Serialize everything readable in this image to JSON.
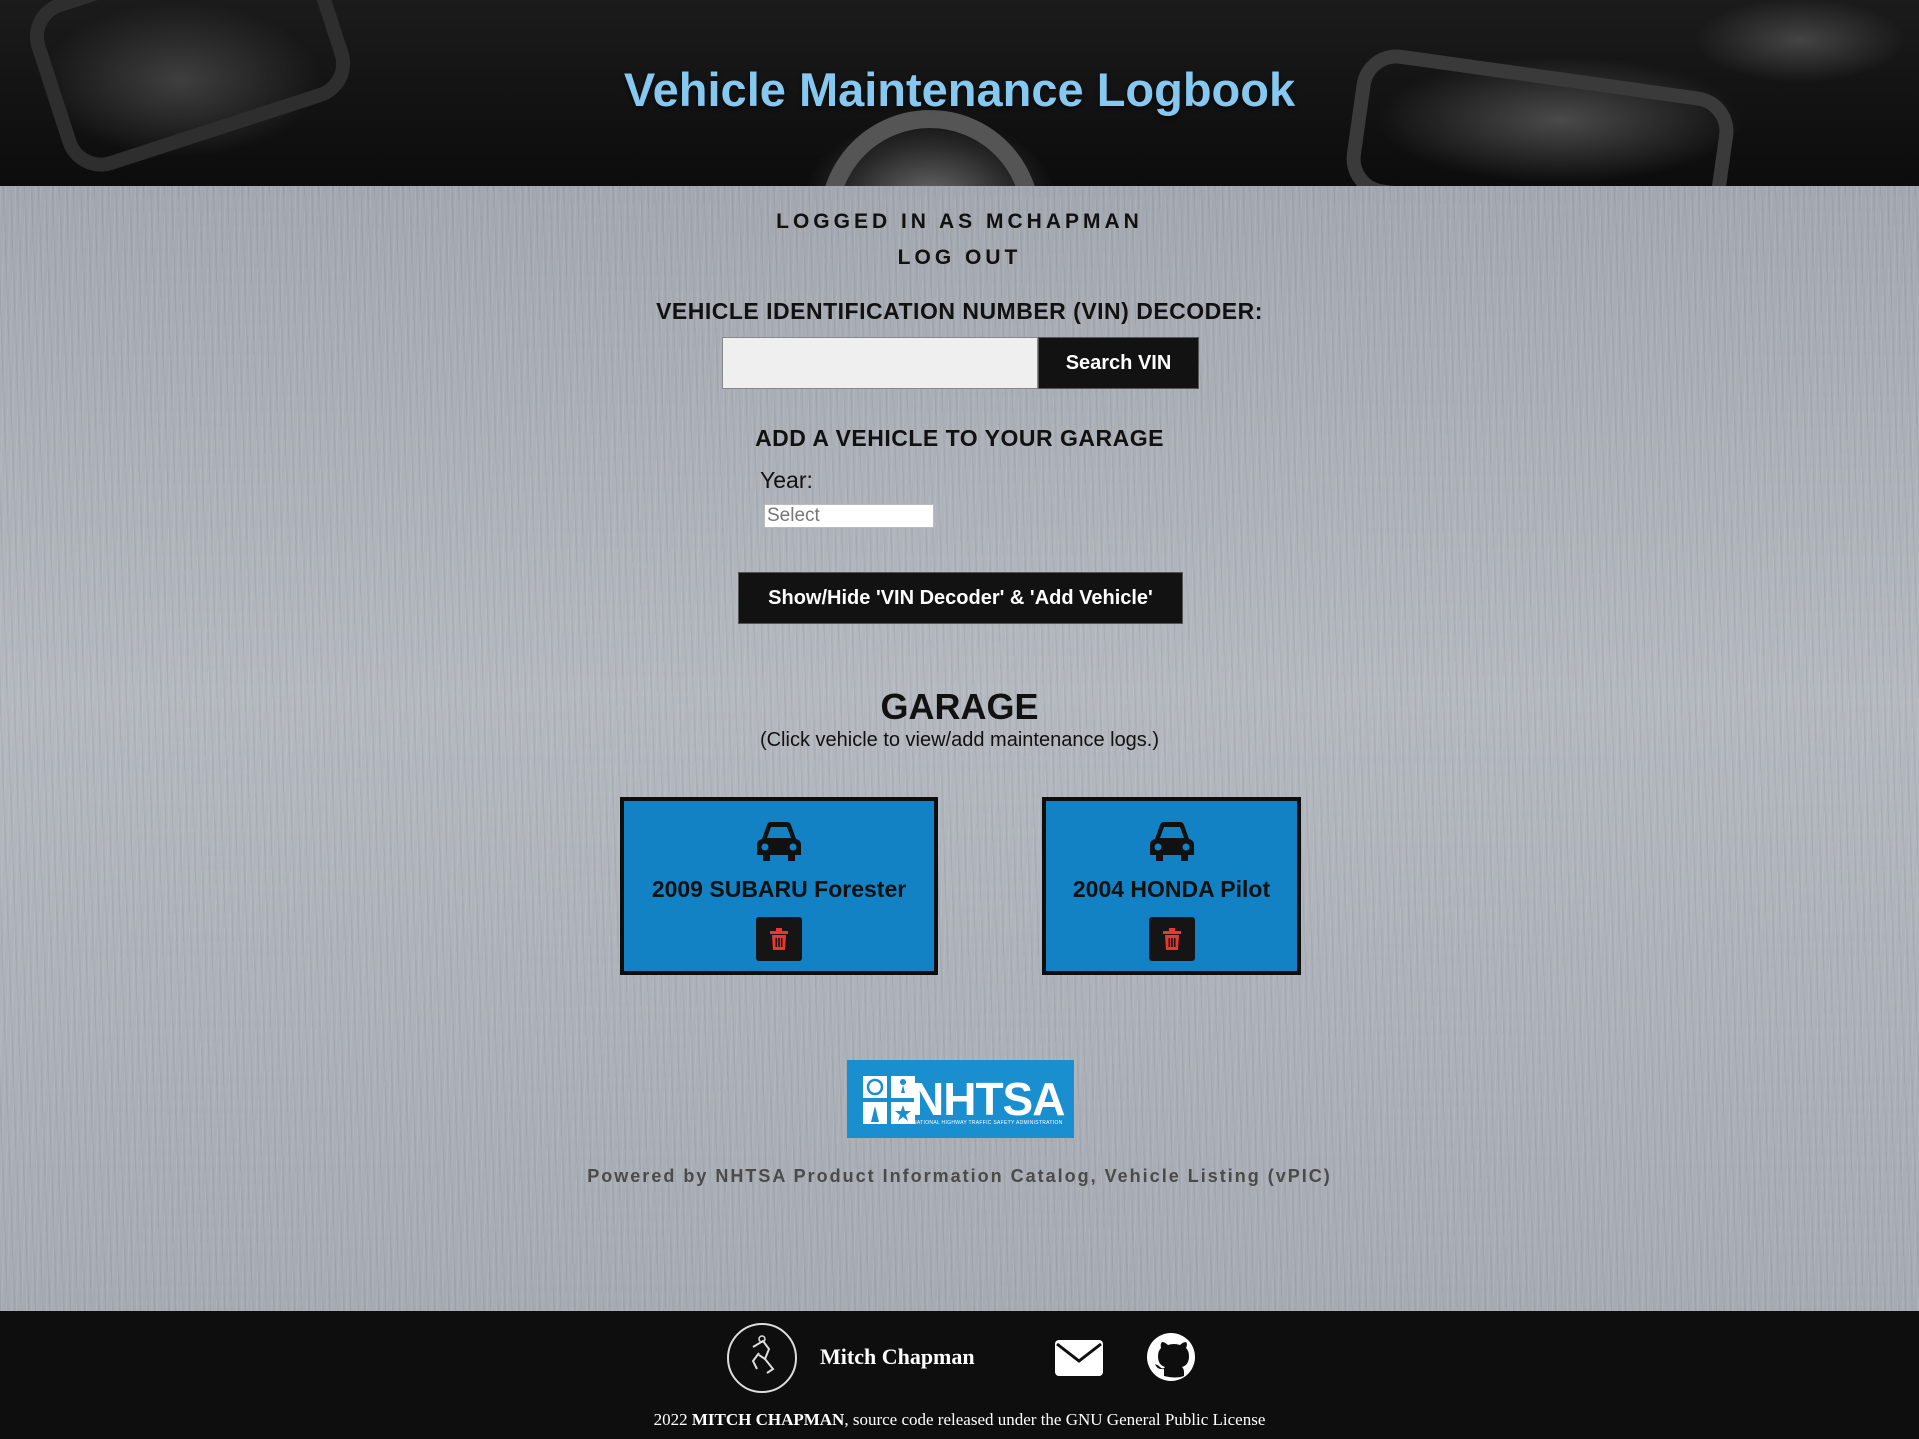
{
  "header": {
    "title": "Vehicle Maintenance Logbook"
  },
  "account": {
    "logged_in": "LOGGED IN AS MCHAPMAN",
    "logout": "LOG OUT"
  },
  "vin": {
    "label": "VEHICLE IDENTIFICATION NUMBER (VIN) DECODER:",
    "value": "",
    "button": "Search VIN"
  },
  "add_vehicle": {
    "heading": "ADD A VEHICLE TO YOUR GARAGE",
    "year_label": "Year:",
    "year_value": "Select"
  },
  "toggle_button": "Show/Hide 'VIN Decoder' & 'Add Vehicle'",
  "garage": {
    "title": "GARAGE",
    "subtitle": "(Click vehicle to view/add maintenance logs.)",
    "vehicles": [
      {
        "name": "2009 SUBARU Forester"
      },
      {
        "name": "2004 HONDA Pilot"
      }
    ]
  },
  "nhtsa": {
    "logo_text": "NHTSA",
    "logo_sub": "NATIONAL HIGHWAY TRAFFIC SAFETY ADMINISTRATION",
    "powered": "Powered by NHTSA Product Information Catalog, Vehicle Listing (vPIC)"
  },
  "footer": {
    "author": "Mitch Chapman",
    "copyright_year": "2022",
    "copyright_name": "MITCH CHAPMAN",
    "copyright_rest": ", source code released under the GNU General Public License"
  },
  "colors": {
    "title": "#86c8ef",
    "card": "#1282c4",
    "trash": "#e53935",
    "nhtsa": "#1a8fd0"
  }
}
